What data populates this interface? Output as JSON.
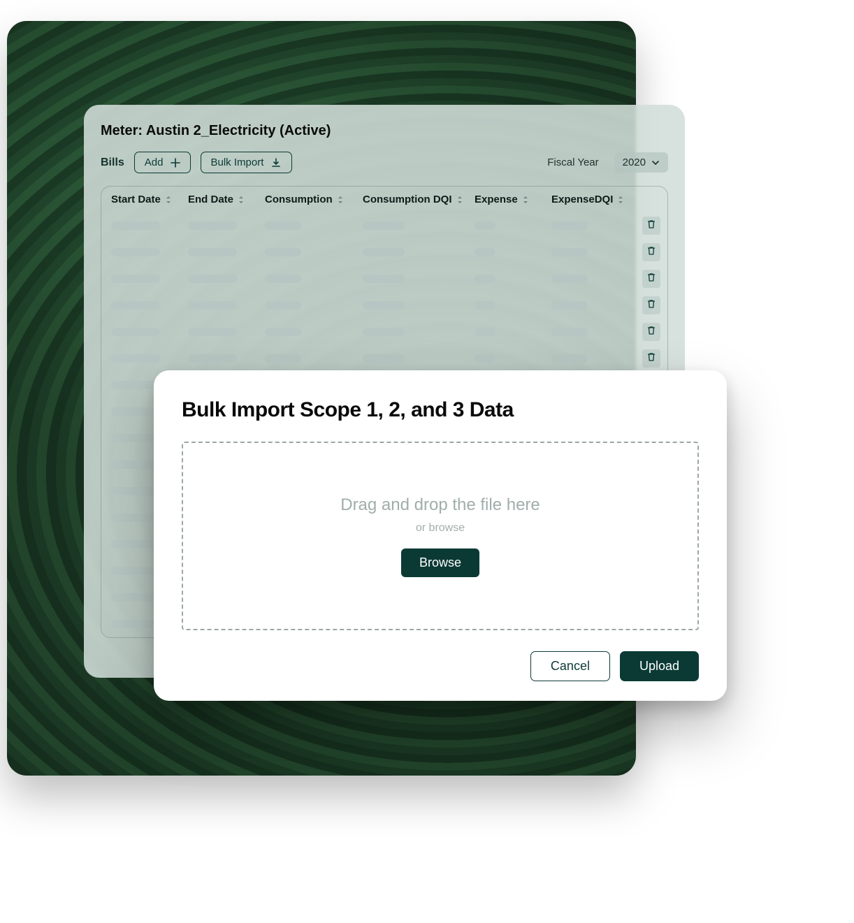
{
  "panel": {
    "title": "Meter: Austin 2_Electricity (Active)",
    "bills_label": "Bills",
    "add_label": "Add",
    "bulk_import_label": "Bulk Import",
    "fiscal_year_label": "Fiscal Year",
    "fiscal_year_value": "2020"
  },
  "columns": [
    "Start Date",
    "End Date",
    "Consumption",
    "Consumption DQI",
    "Expense",
    "ExpenseDQI"
  ],
  "row_count": 16,
  "modal": {
    "title": "Bulk Import Scope 1, 2, and 3 Data",
    "drop_main": "Drag and drop the file here",
    "drop_sub": "or browse",
    "browse_label": "Browse",
    "cancel_label": "Cancel",
    "upload_label": "Upload"
  },
  "colors": {
    "accent": "#0b3a35",
    "placeholder": "#b7c6c2"
  }
}
